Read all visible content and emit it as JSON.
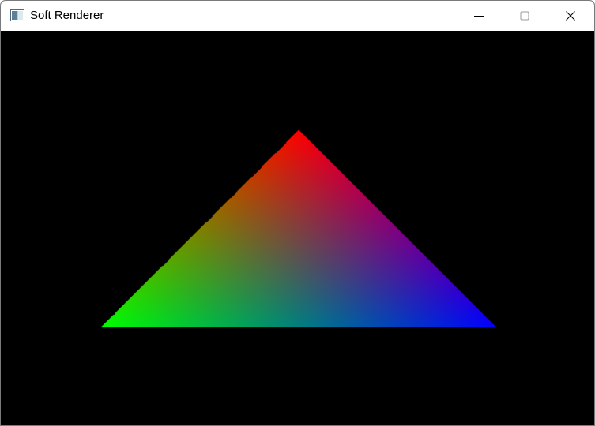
{
  "window": {
    "title": "Soft Renderer",
    "app_icon": "app-window-icon",
    "controls": {
      "minimize_icon": "minimize-icon",
      "maximize_icon": "maximize-icon",
      "close_icon": "close-icon"
    }
  },
  "scene": {
    "background": "#000000",
    "triangle": {
      "vertex_colors": [
        "#ff0000",
        "#00ff00",
        "#0000ff"
      ]
    }
  }
}
